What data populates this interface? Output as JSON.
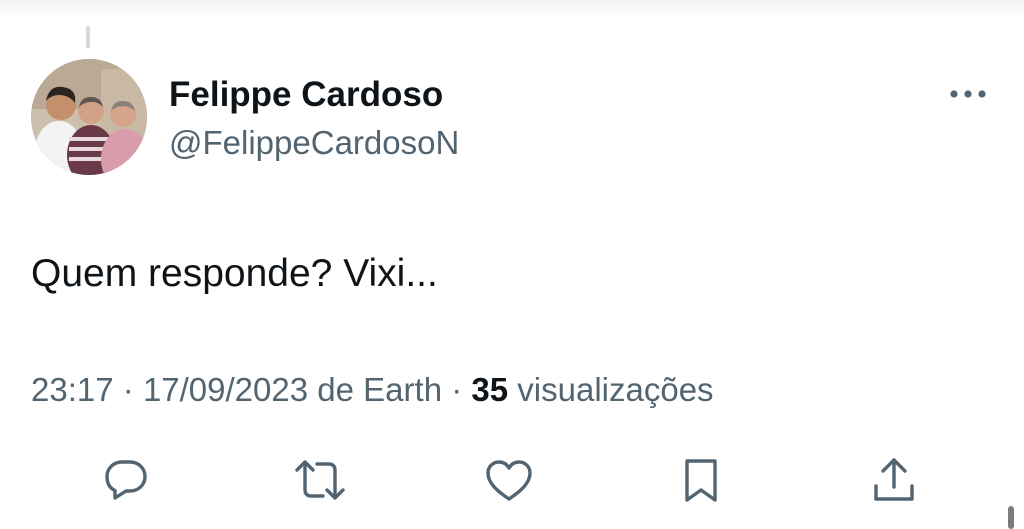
{
  "tweet": {
    "author": {
      "display_name": "Felippe Cardoso",
      "handle": "@FelippeCardosoN"
    },
    "text": "Quem responde? Vixi...",
    "meta": {
      "time": "23:17",
      "separator1": "·",
      "date": "17/09/2023",
      "source_prefix": "de",
      "source": "Earth",
      "separator2": "·",
      "views_count": "35",
      "views_label": "visualizações"
    }
  },
  "icons": {
    "more": "more-horizontal-icon",
    "reply": "reply-icon",
    "retweet": "retweet-icon",
    "like": "heart-icon",
    "bookmark": "bookmark-icon",
    "share": "share-icon"
  },
  "colors": {
    "text_primary": "#0f1419",
    "text_secondary": "#536471",
    "icon": "#536471",
    "background": "#ffffff"
  }
}
